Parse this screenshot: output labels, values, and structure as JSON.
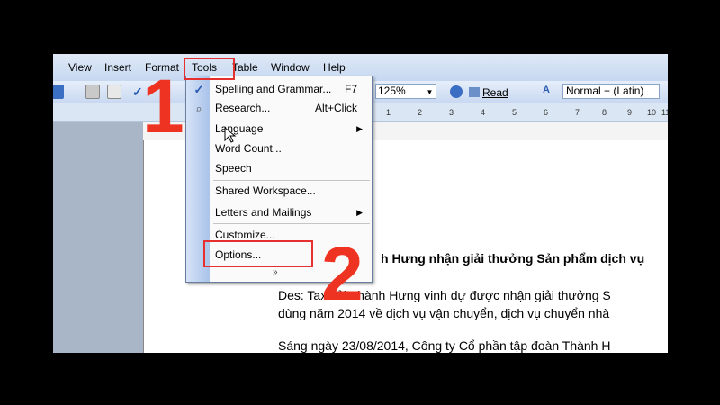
{
  "menubar": {
    "items": [
      "View",
      "Insert",
      "Format",
      "Tools",
      "Table",
      "Window",
      "Help"
    ]
  },
  "toolbar": {
    "zoom_value": "125%",
    "read_label": "Read",
    "style_value": "Normal + (Latin)"
  },
  "ruler": {
    "ticks": [
      "1",
      "2",
      "3",
      "4",
      "5",
      "6",
      "7",
      "8",
      "9",
      "10",
      "11"
    ]
  },
  "tools_menu": {
    "items": [
      {
        "label": "Spelling and Grammar...",
        "shortcut": "F7",
        "icon": "spellcheck-icon"
      },
      {
        "label": "Research...",
        "shortcut": "Alt+Click",
        "icon": "research-icon"
      },
      {
        "label": "Language",
        "submenu": true
      },
      {
        "label": "Word Count..."
      },
      {
        "label": "Speech"
      },
      {
        "label": "Shared Workspace..."
      },
      {
        "label": "Letters and Mailings",
        "submenu": true
      },
      {
        "label": "Customize..."
      },
      {
        "label": "Options..."
      }
    ],
    "expand_glyph": "»"
  },
  "document": {
    "title_fragment": "h Hưng nhận giải thưởng Sản phẩm dịch vụ",
    "para1_line1": "Des: Taxi tải Thành Hưng vinh dự được nhận giải thưởng S",
    "para1_line2": "dùng năm 2014 về dịch vụ vận chuyển, dịch vụ chuyển nhà",
    "para2_line1": "Sáng ngày 23/08/2014, Công ty Cổ phần tập đoàn Thành H"
  },
  "annotations": {
    "step1": "1",
    "step2": "2",
    "color": "#ef3322"
  }
}
